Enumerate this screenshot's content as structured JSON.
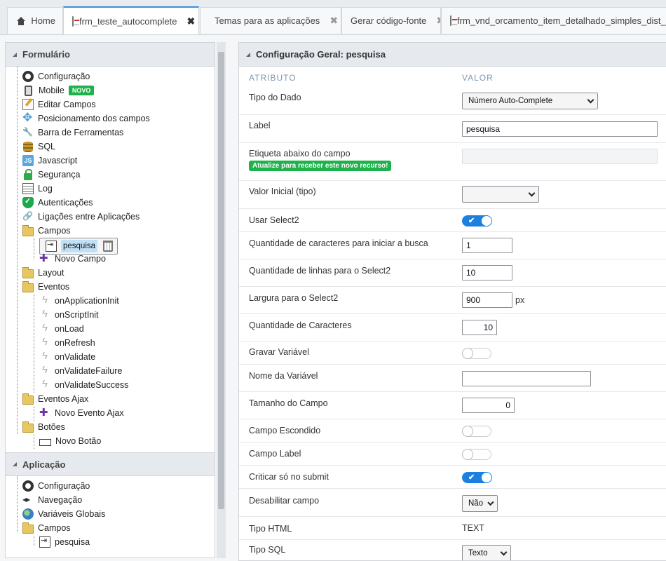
{
  "tabs": [
    {
      "label": "Home",
      "icon": "home-icon"
    },
    {
      "label": "frm_teste_autocomplete",
      "icon": "form-icon"
    },
    {
      "label": "Temas para as aplicações",
      "icon": "palette-icon"
    },
    {
      "label": "Gerar código-fonte",
      "icon": ""
    },
    {
      "label": "frm_vnd_orcamento_item_detalhado_simples_dist_div",
      "icon": "form-icon"
    }
  ],
  "close_glyph": "✖",
  "formulario": {
    "title": "Formulário",
    "items": {
      "configuracao": "Configuração",
      "mobile": "Mobile",
      "mobile_badge": "NOVO",
      "editar_campos": "Editar Campos",
      "posicionamento": "Posicionamento dos campos",
      "barra": "Barra de Ferramentas",
      "sql": "SQL",
      "javascript": "Javascript",
      "seguranca": "Segurança",
      "log": "Log",
      "autenticacoes": "Autenticações",
      "ligacoes": "Ligações entre Aplicações",
      "campos": "Campos",
      "pesquisa": "pesquisa",
      "novo_campo": "Novo Campo",
      "layout": "Layout",
      "eventos": "Eventos",
      "on_app_init": "onApplicationInit",
      "on_script_init": "onScriptInit",
      "on_load": "onLoad",
      "on_refresh": "onRefresh",
      "on_validate": "onValidate",
      "on_validate_failure": "onValidateFailure",
      "on_validate_success": "onValidateSuccess",
      "eventos_ajax": "Eventos Ajax",
      "novo_evento_ajax": "Novo Evento Ajax",
      "botoes": "Botões",
      "novo_botao": "Novo Botão"
    }
  },
  "aplicacao": {
    "title": "Aplicação",
    "items": {
      "configuracao": "Configuração",
      "navegacao": "Navegação",
      "variaveis": "Variáveis Globais",
      "campos": "Campos",
      "pesquisa": "pesquisa"
    }
  },
  "config": {
    "title": "Configuração Geral: pesquisa",
    "col_atributo": "ATRIBUTO",
    "col_valor": "VALOR",
    "tipo_dado": {
      "label": "Tipo do Dado",
      "value": "Número Auto-Complete"
    },
    "label": {
      "label": "Label",
      "value": "pesquisa"
    },
    "etiqueta": {
      "label": "Etiqueta abaixo do campo",
      "upgrade": "Atualize para receber este novo recurso!"
    },
    "valor_inicial": {
      "label": "Valor Inicial (tipo)",
      "value": ""
    },
    "usar_select2": {
      "label": "Usar Select2",
      "on": true
    },
    "qtd_caracteres_busca": {
      "label": "Quantidade de caracteres para iniciar a busca",
      "value": "1"
    },
    "qtd_linhas": {
      "label": "Quantidade de linhas para o Select2",
      "value": "10"
    },
    "largura": {
      "label": "Largura para o Select2",
      "value": "900",
      "unit": "px"
    },
    "qtd_caracteres": {
      "label": "Quantidade de Caracteres",
      "value": "10"
    },
    "gravar_variavel": {
      "label": "Gravar Variável",
      "on": false
    },
    "nome_variavel": {
      "label": "Nome da Variável",
      "value": ""
    },
    "tamanho_campo": {
      "label": "Tamanho do Campo",
      "value": "0"
    },
    "campo_escondido": {
      "label": "Campo Escondido",
      "on": false
    },
    "campo_label": {
      "label": "Campo Label",
      "on": false
    },
    "criticar": {
      "label": "Criticar só no submit",
      "on": true
    },
    "desabilitar": {
      "label": "Desabilitar campo",
      "value": "Não"
    },
    "tipo_html": {
      "label": "Tipo HTML",
      "value": "TEXT"
    },
    "tipo_sql": {
      "label": "Tipo SQL",
      "value": "Texto"
    }
  },
  "toggle_check": "✔",
  "colors": {
    "accent": "#1b80e0",
    "badge": "#1db34a",
    "selection": "#bfe0f7"
  }
}
